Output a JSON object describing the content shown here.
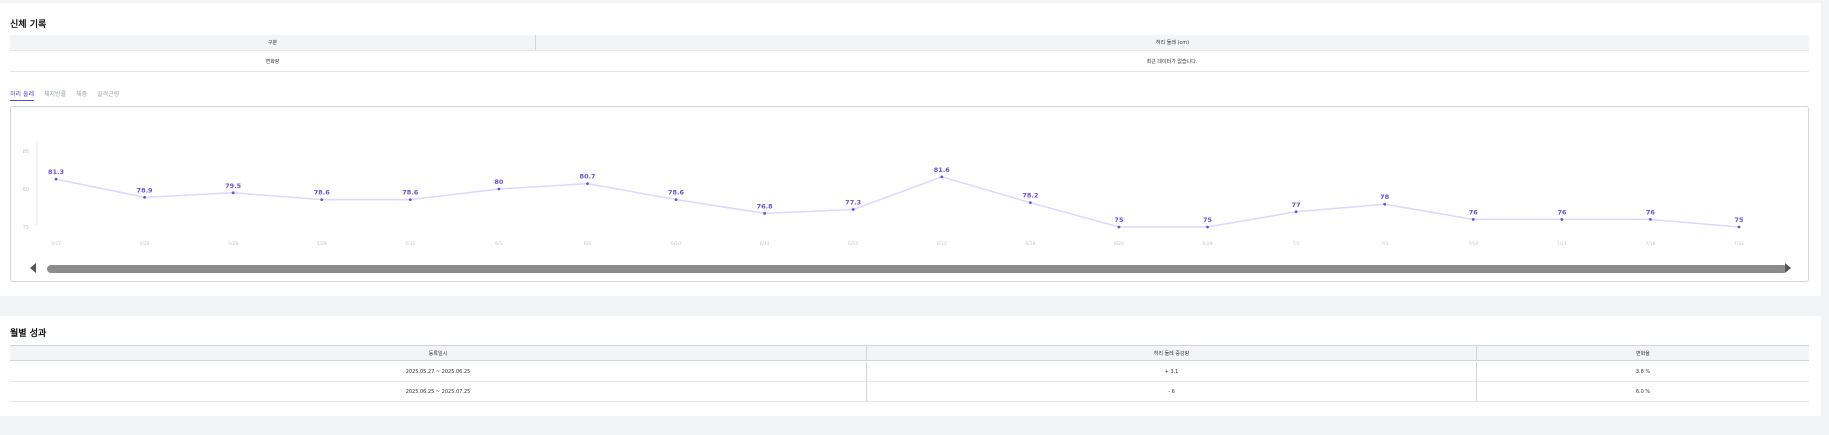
{
  "body_record": {
    "title": "신체 기록",
    "table_headers": [
      "구분",
      "허리 둘레 (cm)"
    ],
    "row": {
      "label": "변화량",
      "value": "최근 데이터가 없습니다."
    }
  },
  "tabs": [
    "허리 둘레",
    "체지방률",
    "체중",
    "골격근량"
  ],
  "active_tab_index": 0,
  "chart_data": {
    "type": "line",
    "categories": [
      "5/27",
      "5/28",
      "5/28",
      "5/29",
      "5/31",
      "6/1",
      "6/5",
      "6/10",
      "6/11",
      "6/15",
      "6/15",
      "6/18",
      "6/20",
      "6/29",
      "7/2",
      "7/3",
      "7/10",
      "7/11",
      "7/18",
      "7/22"
    ],
    "values": [
      81.3,
      78.9,
      79.5,
      78.6,
      78.6,
      80,
      80.7,
      78.6,
      76.8,
      77.3,
      81.6,
      78.2,
      75,
      75,
      77,
      78,
      76,
      76,
      76,
      75
    ],
    "value_labels": [
      "81.3",
      "78.9",
      "79.5",
      "78.6",
      "78.6",
      "80",
      "80.7",
      "78.6",
      "76.8",
      "77.3",
      "81.6",
      "78.2",
      "75",
      "75",
      "77",
      "78",
      "76",
      "76",
      "76",
      "75"
    ],
    "y_ticks": [
      "85",
      "80",
      "75"
    ],
    "ylim": [
      75,
      85
    ],
    "line_color": "#ddd6fe",
    "point_color": "#6d4fd8",
    "label_color": "#6d4fd8",
    "grid": false,
    "legend": false
  },
  "monthly": {
    "title": "월별 성과",
    "headers": [
      "등록일시",
      "허리 둘레 증감량",
      "변화율"
    ],
    "rows": [
      [
        "2025.05.27 ~ 2025.06.25",
        "+ 3.1",
        "3.8 %"
      ],
      [
        "2025.06.25 ~ 2025.07.25",
        "- 6",
        "6.0 %"
      ]
    ]
  },
  "colors": {
    "accent": "#4f46e5",
    "background": "#f3f4f6",
    "card": "#ffffff"
  }
}
